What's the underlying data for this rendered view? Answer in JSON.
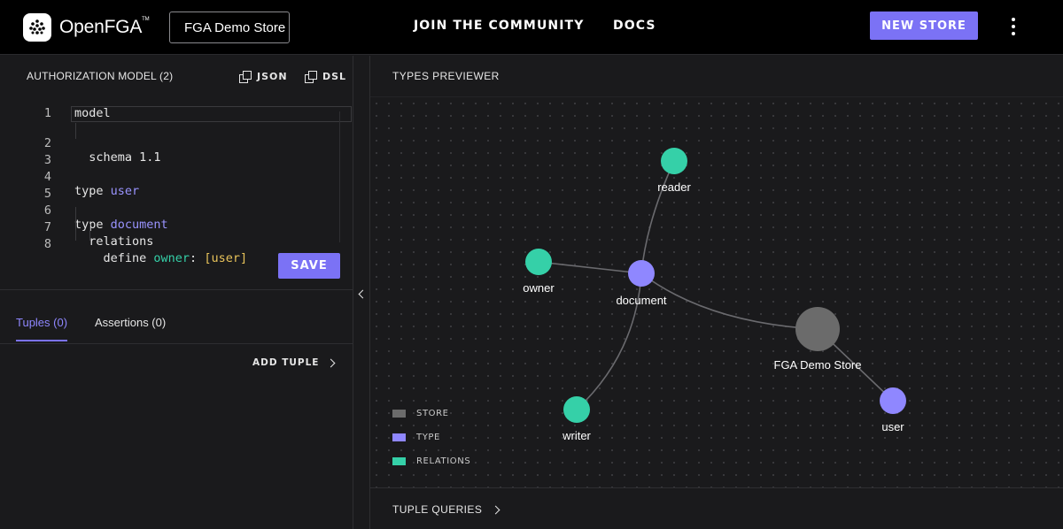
{
  "header": {
    "logo_text": "OpenFGA",
    "logo_tm": "TM",
    "store_name": "FGA Demo Store",
    "nav_community": "JOIN  THE COMMUNITY",
    "nav_docs": "DOCS",
    "new_store_label": "NEW STORE",
    "menu_icon": "kebab-vertical-icon"
  },
  "model_panel": {
    "title": "AUTHORIZATION MODEL (2)",
    "json_label": "JSON",
    "dsl_label": "DSL",
    "copy_icon": "copy-icon",
    "code_lines": [
      {
        "n": "1",
        "text": "model"
      },
      {
        "n": "2",
        "text": "  schema 1.1"
      },
      {
        "n": "3",
        "text": ""
      },
      {
        "n": "4",
        "a": "type ",
        "b": "user"
      },
      {
        "n": "5",
        "text": ""
      },
      {
        "n": "6",
        "a": "type ",
        "b": "document"
      },
      {
        "n": "7",
        "text": "  relations"
      },
      {
        "n": "8",
        "a": "    define ",
        "b": "owner",
        "c": ": ",
        "d": "[user]"
      }
    ],
    "save_label": "SAVE"
  },
  "tabs": {
    "tuples": "Tuples (0)",
    "assertions": "Assertions (0)",
    "add_tuple": "ADD TUPLE"
  },
  "previewer": {
    "title": "TYPES PREVIEWER",
    "tuple_queries": "TUPLE QUERIES",
    "nodes": [
      {
        "id": "reader",
        "label": "reader",
        "kind": "relation"
      },
      {
        "id": "owner",
        "label": "owner",
        "kind": "relation"
      },
      {
        "id": "document",
        "label": "document",
        "kind": "type"
      },
      {
        "id": "store",
        "label": "FGA Demo Store",
        "kind": "store"
      },
      {
        "id": "writer",
        "label": "writer",
        "kind": "relation"
      },
      {
        "id": "user",
        "label": "user",
        "kind": "type"
      }
    ],
    "legend": [
      {
        "label": "STORE",
        "color": "#6b6b6b"
      },
      {
        "label": "TYPE",
        "color": "#8f87ff"
      },
      {
        "label": "RELATIONS",
        "color": "#35d0a8"
      }
    ]
  },
  "colors": {
    "accent": "#7b72f5",
    "type_node": "#8f87ff",
    "relation_node": "#35d0a8",
    "store_node": "#6b6b6b"
  }
}
